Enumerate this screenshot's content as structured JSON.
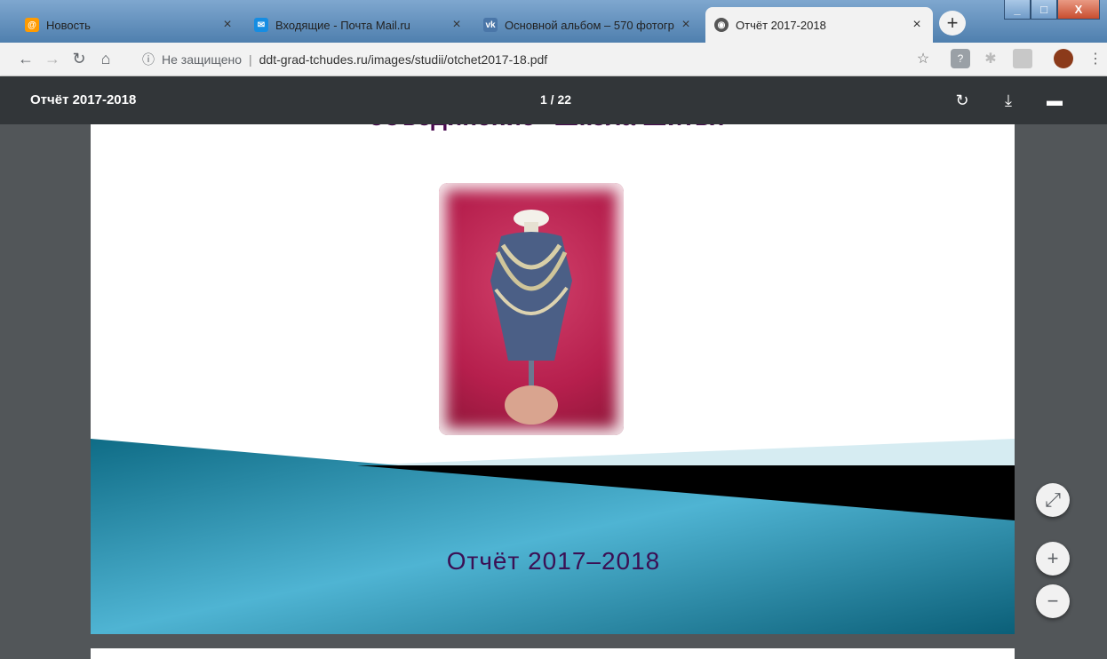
{
  "tabs": [
    {
      "title": "Новость",
      "favicon": "mail-at-icon",
      "color": "#1a7ad8",
      "active": false
    },
    {
      "title": "Входящие - Почта Mail.ru",
      "favicon": "envelope-icon",
      "color": "#168de2",
      "active": false
    },
    {
      "title": "Основной альбом – 570 фотогр",
      "favicon": "vk-icon",
      "color": "#4a76a8",
      "active": false
    },
    {
      "title": "Отчёт 2017-2018",
      "favicon": "globe-icon",
      "color": "#555",
      "active": true
    }
  ],
  "address": {
    "security": "Не защищено",
    "url": "ddt-grad-tchudes.ru/images/studii/otchet2017-18.pdf"
  },
  "pdf": {
    "title": "Отчёт 2017-2018",
    "page_indicator": "1 / 22"
  },
  "document": {
    "heading": "объединение \"Школа Шитья\"",
    "banner_title": "Отчёт 2017–2018"
  }
}
